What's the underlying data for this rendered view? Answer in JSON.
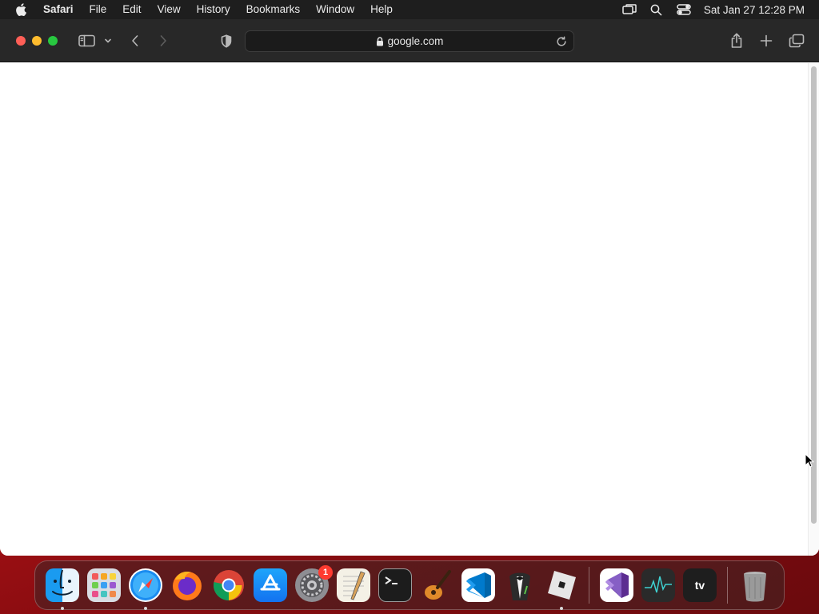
{
  "menubar": {
    "app_name": "Safari",
    "items": [
      "File",
      "Edit",
      "View",
      "History",
      "Bookmarks",
      "Window",
      "Help"
    ],
    "clock": "Sat Jan 27  12:28 PM"
  },
  "browser": {
    "url": "google.com"
  },
  "dock": {
    "apps": [
      {
        "name": "Finder",
        "icon": "finder-icon",
        "running": true
      },
      {
        "name": "Launchpad",
        "icon": "launchpad-icon",
        "running": false
      },
      {
        "name": "Safari",
        "icon": "safari-icon",
        "running": true
      },
      {
        "name": "Firefox",
        "icon": "firefox-icon",
        "running": false
      },
      {
        "name": "Google Chrome",
        "icon": "chrome-icon",
        "running": false
      },
      {
        "name": "App Store",
        "icon": "app-store-icon",
        "running": false
      },
      {
        "name": "System Settings",
        "icon": "settings-icon",
        "running": false,
        "badge": "1"
      },
      {
        "name": "TextEdit",
        "icon": "textedit-icon",
        "running": false
      },
      {
        "name": "Terminal",
        "icon": "terminal-icon",
        "running": false
      },
      {
        "name": "GarageBand",
        "icon": "garageband-icon",
        "running": false
      },
      {
        "name": "Visual Studio Code",
        "icon": "vscode-icon",
        "running": false
      },
      {
        "name": "Bartender",
        "icon": "bartender-icon",
        "running": false
      },
      {
        "name": "Roblox",
        "icon": "roblox-icon",
        "running": true
      },
      {
        "name": "Visual Studio",
        "icon": "visual-studio-icon",
        "running": false
      },
      {
        "name": "Activity Monitor",
        "icon": "activity-monitor-icon",
        "running": false
      },
      {
        "name": "Apple TV",
        "icon": "apple-tv-icon",
        "running": false,
        "label": "tv"
      },
      {
        "name": "Trash",
        "icon": "trash-icon",
        "running": false
      }
    ]
  },
  "colors": {
    "menubar_bg": "#1e1e1e",
    "toolbar_bg": "#282828",
    "close": "#ff5f57",
    "minimize": "#febc2e",
    "maximize": "#28c840",
    "wallpaper": "#c2161b"
  }
}
